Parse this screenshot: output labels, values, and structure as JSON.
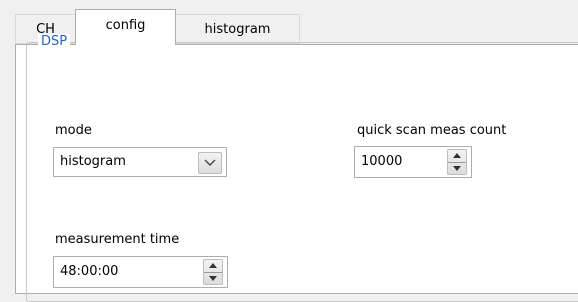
{
  "tabs": [
    {
      "label": "CH"
    },
    {
      "label": "config"
    },
    {
      "label": "histogram"
    }
  ],
  "group": {
    "title": "DSP"
  },
  "mode": {
    "label": "mode",
    "value": "histogram"
  },
  "quick_scan": {
    "label": "quick scan meas count",
    "value": "10000"
  },
  "measurement_time": {
    "label": "measurement time",
    "value": "48:00:00"
  },
  "icons": {
    "combo_arrow": "chevron-down-icon",
    "spin_up": "triangle-up-icon",
    "spin_down": "triangle-down-icon"
  }
}
